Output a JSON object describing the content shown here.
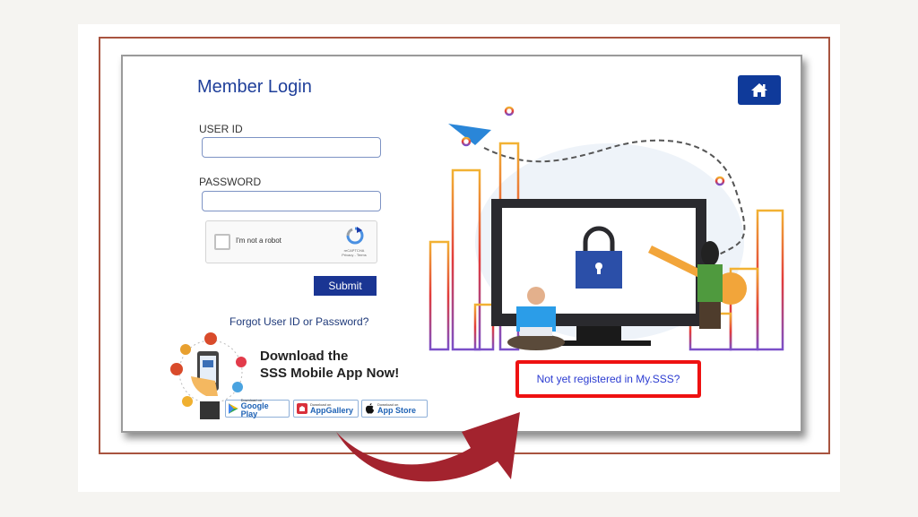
{
  "login": {
    "title": "Member Login",
    "user_id_label": "USER ID",
    "user_id_value": "",
    "password_label": "PASSWORD",
    "password_value": "",
    "captcha_label": "I'm not a robot",
    "captcha_brand": "reCAPTCHA",
    "captcha_links": "Privacy - Terms",
    "submit_label": "Submit",
    "forgot_link": "Forgot User ID or Password?"
  },
  "app_promo": {
    "line1": "Download the",
    "line2": "SSS Mobile App Now!",
    "stores": [
      {
        "small": "Download on",
        "name": "Google Play",
        "icon": "google-play-icon"
      },
      {
        "small": "Download on",
        "name": "AppGallery",
        "icon": "huawei-appgallery-icon"
      },
      {
        "small": "Download on",
        "name": "App Store",
        "icon": "apple-icon"
      }
    ]
  },
  "header": {
    "home_icon": "home-icon"
  },
  "register_link": "Not yet registered in My.SSS?",
  "colors": {
    "brand_blue": "#1a3593",
    "highlight_red": "#ee1111",
    "arrow_red": "#a3232e",
    "frame_brown": "#a8543f"
  }
}
